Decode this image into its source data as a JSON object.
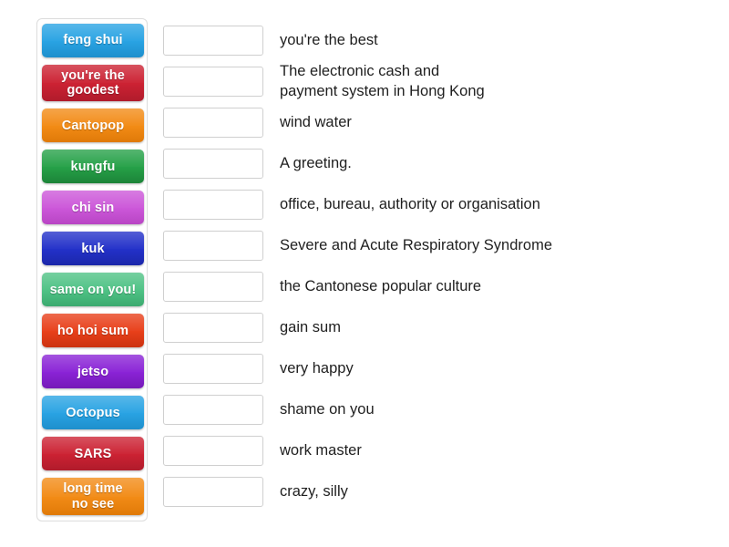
{
  "activity": {
    "type": "match-up",
    "tray_label": "draggable answer tiles",
    "tiles": [
      {
        "label": "feng shui",
        "color": "#29A3E3",
        "color_dark": "#1E8FCC",
        "lines": [
          "feng shui"
        ]
      },
      {
        "label": "you're the goodest",
        "color": "#CC2233",
        "color_dark": "#B01B2B",
        "lines": [
          "you're the",
          "goodest"
        ]
      },
      {
        "label": "Cantopop",
        "color": "#F28B16",
        "color_dark": "#E07A08",
        "lines": [
          "Cantopop"
        ]
      },
      {
        "label": "kungfu",
        "color": "#26A148",
        "color_dark": "#1C8438",
        "lines": [
          "kungfu"
        ]
      },
      {
        "label": "chi sin",
        "color": "#CC57D9",
        "color_dark": "#B845C4",
        "lines": [
          "chi sin"
        ]
      },
      {
        "label": "kuk",
        "color": "#2331C9",
        "color_dark": "#1B27AA",
        "lines": [
          "kuk"
        ]
      },
      {
        "label": "same on you!",
        "color": "#4FC285",
        "color_dark": "#3BAA6F",
        "lines": [
          "same on you!"
        ]
      },
      {
        "label": "ho hoi sum",
        "color": "#E8401A",
        "color_dark": "#CC3210",
        "lines": [
          "ho hoi sum"
        ]
      },
      {
        "label": "jetso",
        "color": "#8A23D6",
        "color_dark": "#7519B8",
        "lines": [
          "jetso"
        ]
      },
      {
        "label": "Octopus",
        "color": "#29A3E3",
        "color_dark": "#1E8FCC",
        "lines": [
          "Octopus"
        ]
      },
      {
        "label": "SARS",
        "color": "#CC2233",
        "color_dark": "#B01B2B",
        "lines": [
          "SARS"
        ]
      },
      {
        "label": "long time no see",
        "color": "#F28B16",
        "color_dark": "#E07A08",
        "lines": [
          "long time",
          "no see"
        ]
      }
    ],
    "answers": [
      {
        "lines": [
          "you're the best"
        ]
      },
      {
        "lines": [
          "The electronic cash and",
          "payment system in Hong Kong"
        ]
      },
      {
        "lines": [
          "wind water"
        ]
      },
      {
        "lines": [
          "A greeting."
        ]
      },
      {
        "lines": [
          "office, bureau, authority or organisation"
        ]
      },
      {
        "lines": [
          "Severe and Acute Respiratory Syndrome"
        ]
      },
      {
        "lines": [
          "the Cantonese popular culture"
        ]
      },
      {
        "lines": [
          "gain sum"
        ]
      },
      {
        "lines": [
          "very happy"
        ]
      },
      {
        "lines": [
          "shame on you"
        ]
      },
      {
        "lines": [
          "work master"
        ]
      },
      {
        "lines": [
          "crazy, silly"
        ]
      }
    ],
    "drop_zone_placeholder": ""
  }
}
